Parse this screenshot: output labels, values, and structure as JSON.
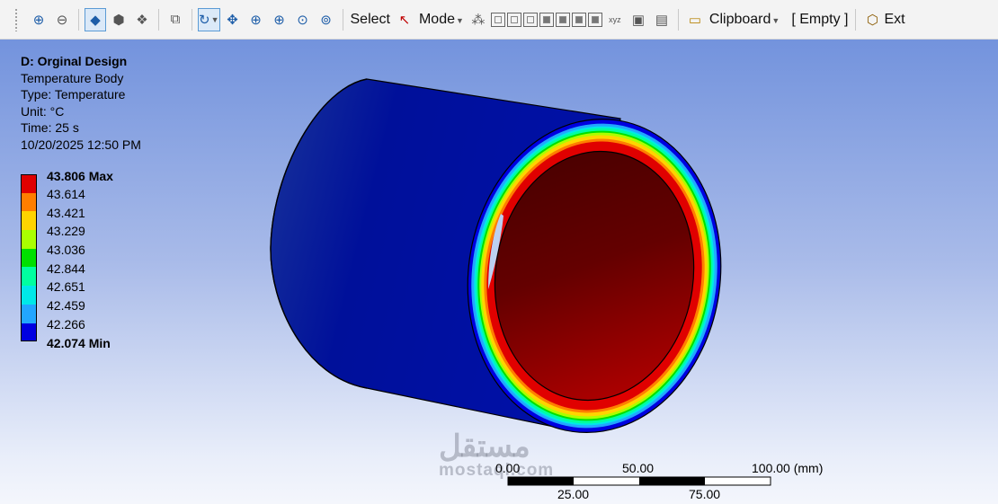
{
  "toolbar": {
    "select_label": "Select",
    "mode_label": "Mode",
    "clipboard_label": "Clipboard",
    "empty_label": "[ Empty ]",
    "extend_label": "Ext"
  },
  "result": {
    "title": "D: Orginal Design",
    "name": "Temperature  Body",
    "type": "Type: Temperature",
    "unit": "Unit: °C",
    "time": "Time: 25 s",
    "date": "10/20/2025 12:50 PM"
  },
  "legend": {
    "max_label": "43.806 Max",
    "min_label": "42.074 Min",
    "values": [
      "43.614",
      "43.421",
      "43.229",
      "43.036",
      "42.844",
      "42.651",
      "42.459",
      "42.266"
    ],
    "colors": [
      "#e00000",
      "#ff7e00",
      "#ffd400",
      "#aaff00",
      "#00e000",
      "#00ffa0",
      "#00e8e8",
      "#22a6ff",
      "#0000e0"
    ]
  },
  "scale_bar": {
    "top_labels": [
      "0.00",
      "50.00",
      "100.00 (mm)"
    ],
    "bottom_labels": [
      "25.00",
      "75.00"
    ]
  },
  "watermark": {
    "arabic": "مستقل",
    "latin": "mostaql.com"
  }
}
